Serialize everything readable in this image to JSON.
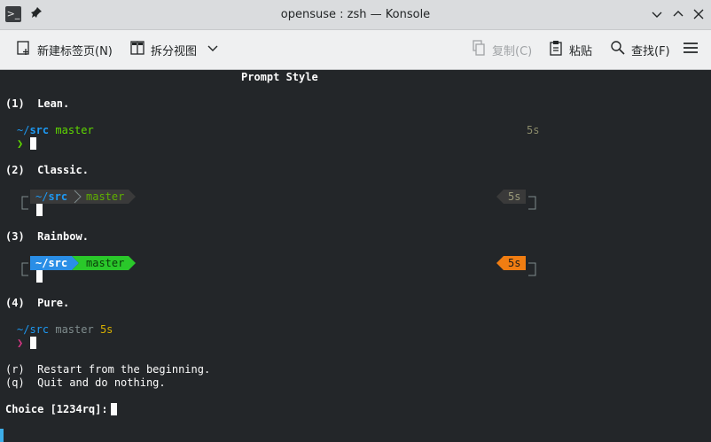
{
  "window": {
    "title": "opensuse : zsh — Konsole"
  },
  "toolbar": {
    "new_tab": "新建标签页(N)",
    "split_view": "拆分视图",
    "copy": "复制(C)",
    "paste": "粘贴",
    "find": "查找(F)"
  },
  "terminal": {
    "heading": "Prompt Style",
    "opt1_label": "(1)  Lean.",
    "opt2_label": "(2)  Classic.",
    "opt3_label": "(3)  Rainbow.",
    "opt4_label": "(4)  Pure.",
    "dir_tilde": "~/",
    "dir_name": "src",
    "dir_full": "~/src",
    "branch": "master",
    "duration": "5s",
    "prompt_char": "❯",
    "restart": "(r)  Restart from the beginning.",
    "quit": "(q)  Quit and do nothing.",
    "choice": "Choice [1234rq]: "
  },
  "colors": {
    "accent": "#3daee9",
    "terminal_bg": "#232629",
    "rainbow_blue": "#2a8ee6",
    "rainbow_green": "#2ac82a",
    "rainbow_orange": "#f07d12"
  }
}
